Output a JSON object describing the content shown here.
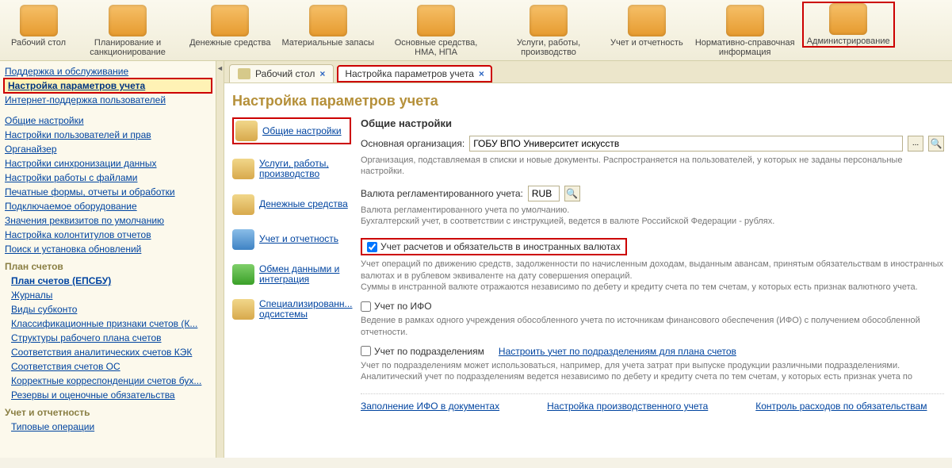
{
  "toolbar": [
    {
      "label": "Рабочий стол",
      "name": "tool-desktop"
    },
    {
      "label": "Планирование и санкционирование",
      "name": "tool-planning"
    },
    {
      "label": "Денежные средства",
      "name": "tool-cash"
    },
    {
      "label": "Материальные запасы",
      "name": "tool-materials"
    },
    {
      "label": "Основные средства, НМА, НПА",
      "name": "tool-assets"
    },
    {
      "label": "Услуги, работы, производство",
      "name": "tool-services"
    },
    {
      "label": "Учет и отчетность",
      "name": "tool-accounting"
    },
    {
      "label": "Нормативно-справочная информация",
      "name": "tool-reference"
    },
    {
      "label": "Администрирование",
      "name": "tool-admin",
      "highlighted": true
    }
  ],
  "sidebar": {
    "top": [
      {
        "label": "Поддержка и обслуживание",
        "name": "sb-support"
      },
      {
        "label": "Настройка параметров учета",
        "name": "sb-params",
        "highlighted": true
      },
      {
        "label": "Интернет-поддержка пользователей",
        "name": "sb-internet"
      }
    ],
    "group1": [
      "Общие настройки",
      "Настройки пользователей и прав",
      "Органайзер",
      "Настройки синхронизации данных",
      "Настройки работы с файлами",
      "Печатные формы, отчеты и обработки",
      "Подключаемое оборудование",
      "Значения реквизитов по умолчанию",
      "Настройка колонтитулов отчетов",
      "Поиск и установка обновлений"
    ],
    "plan_header": "План счетов",
    "plan_items": [
      "План счетов (ЕПСБУ)",
      "Журналы",
      "Виды субконто",
      "Классификационные признаки счетов (К...",
      "Структуры рабочего плана счетов",
      "Соответствия аналитических счетов КЭК",
      "Соответствия счетов ОС",
      "Корректные корреспонденции счетов бух...",
      "Резервы и оценочные обязательства"
    ],
    "report_header": "Учет и отчетность",
    "report_item": "Типовые операции"
  },
  "tabs": [
    {
      "label": "Рабочий стол",
      "name": "tab-desktop",
      "active": false
    },
    {
      "label": "Настройка параметров учета",
      "name": "tab-settings",
      "active": true,
      "highlighted": true
    }
  ],
  "page": {
    "title": "Настройка параметров учета",
    "nav": [
      {
        "label": "Общие настройки",
        "name": "nav-general",
        "highlighted": true,
        "color": ""
      },
      {
        "label": "Услуги, работы, производство",
        "name": "nav-services",
        "color": ""
      },
      {
        "label": "Денежные средства",
        "name": "nav-cash",
        "color": ""
      },
      {
        "label": "Учет и отчетность",
        "name": "nav-accounting",
        "color": "blue"
      },
      {
        "label": "Обмен данными и интеграция",
        "name": "nav-exchange",
        "color": "green"
      },
      {
        "label": "Специализированн... одсистемы",
        "name": "nav-special",
        "color": ""
      }
    ],
    "form": {
      "section_title": "Общие настройки",
      "org_label": "Основная организация:",
      "org_value": "ГОБУ ВПО Университет искусств",
      "org_help": "Организация, подставляемая в списки и новые документы. Распространяется на пользователей, у которых не заданы персональные настройки.",
      "currency_label": "Валюта регламентированного учета:",
      "currency_value": "RUB",
      "currency_help1": "Валюта регламентированного учета по умолчанию.",
      "currency_help2": "Бухгалтерский учет, в соответствии с инструкцией, ведется в валюте Российской Федерации - рублях.",
      "cb_foreign": "Учет расчетов и обязательств в иностранных валютах",
      "foreign_help": "Учет операций по движению средств, задолженности по начисленным доходам, выданным авансам, принятым обязательствам в иностранных валютах и в рублевом эквиваленте на дату совершения операций.\nСуммы в инстранной валюте отражаются независимо по дебету и кредиту счета по тем счетам, у которых есть признак валютного учета.",
      "cb_ifo": "Учет по ИФО",
      "ifo_help": "Ведение в рамках одного учреждения обособленного учета по источникам финансового обеспечения (ИФО) с получением обособленной отчетности.",
      "cb_dept": "Учет по подразделениям",
      "dept_link": "Настроить учет по подразделениям для плана счетов",
      "dept_help": "Учет по подразделениям может использоваться, например, для учета затрат при выпуске продукции различными подразделениями. Аналитический учет по подразделениям ведется независимо по дебету и кредиту счета по тем счетам, у которых есть признак учета по",
      "bottom_links": [
        "Заполнение ИФО в документах",
        "Настройка производственного учета",
        "Контроль расходов по обязательствам"
      ]
    }
  }
}
